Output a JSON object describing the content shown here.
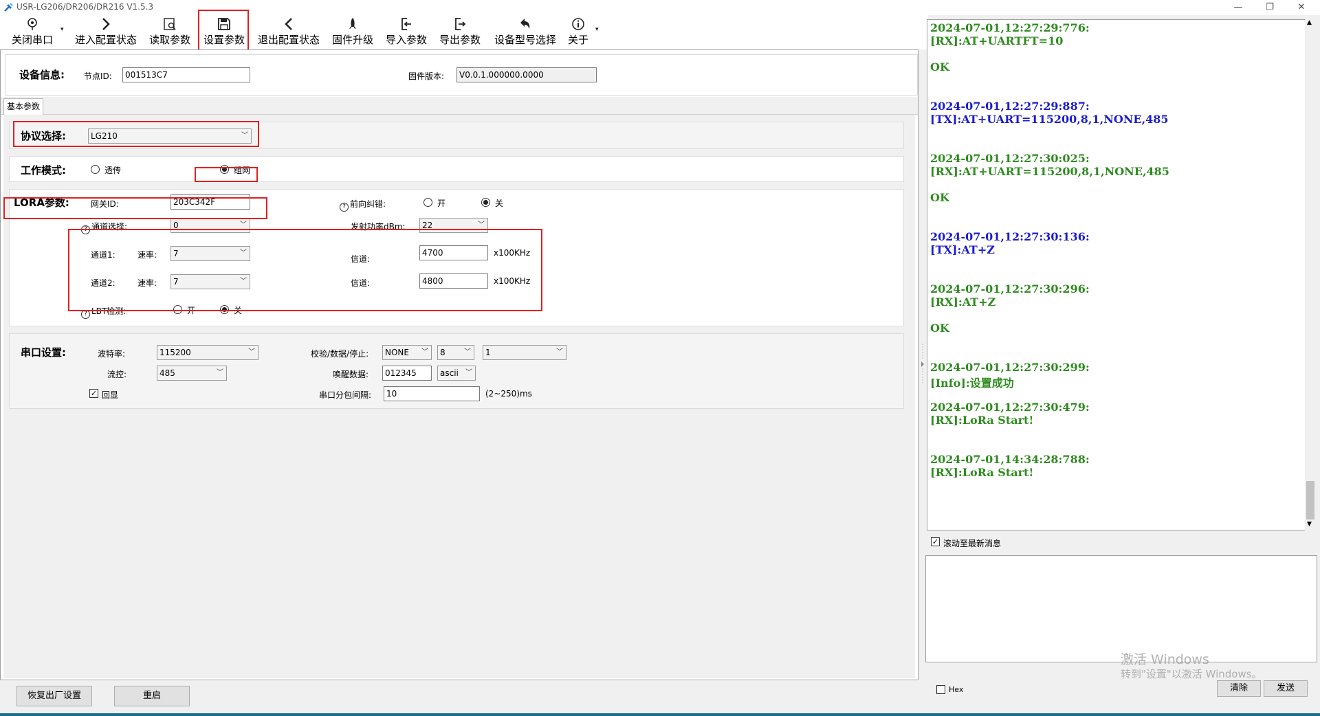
{
  "window": {
    "title": "USR-LG206/DR206/DR216 V1.5.3",
    "icon": "tool-icon"
  },
  "toolbar": {
    "items": [
      {
        "label": "关闭串口",
        "icon": "port-icon"
      },
      {
        "label": "进入配置状态",
        "icon": "chevron-right-icon"
      },
      {
        "label": "读取参数",
        "icon": "read-icon"
      },
      {
        "label": "设置参数",
        "icon": "save-icon"
      },
      {
        "label": "退出配置状态",
        "icon": "chevron-left-icon"
      },
      {
        "label": "固件升级",
        "icon": "rocket-icon"
      },
      {
        "label": "导入参数",
        "icon": "import-icon"
      },
      {
        "label": "导出参数",
        "icon": "export-icon"
      },
      {
        "label": "设备型号选择",
        "icon": "undo-icon"
      },
      {
        "label": "关于",
        "icon": "info-icon"
      }
    ]
  },
  "device": {
    "title": "设备信息:",
    "node_id_label": "节点ID:",
    "node_id": "001513C7",
    "firmware_label": "固件版本:",
    "firmware": "V0.0.1.000000.0000"
  },
  "tabs": {
    "basic": "基本参数"
  },
  "protocol": {
    "label": "协议选择:",
    "value": "LG210"
  },
  "work_mode": {
    "label": "工作模式:",
    "opt_transparent": "透传",
    "opt_network": "组网",
    "selected": "组网"
  },
  "lora": {
    "title": "LORA参数:",
    "gateway_id_label": "网关ID:",
    "gateway_id": "203C342F",
    "fec_label": "前向纠错:",
    "on": "开",
    "off": "关",
    "channel_select_label": "通道选择:",
    "channel_select": "0",
    "tx_power_label": "发射功率dBm:",
    "tx_power": "22",
    "ch1_label": "通道1:",
    "rate_label": "速率:",
    "ch1_rate": "7",
    "channel_label": "信道:",
    "ch1_channel": "4700",
    "unit": "x100KHz",
    "ch2_label": "通道2:",
    "ch2_rate": "7",
    "ch2_channel": "4800",
    "lbt_label": "LBT检测:"
  },
  "serial": {
    "title": "串口设置:",
    "baud_label": "波特率:",
    "baud": "115200",
    "flow_label": "流控:",
    "flow": "485",
    "echo_label": "回显",
    "parity_label": "校验/数据/停止:",
    "parity": "NONE",
    "data_bits": "8",
    "stop_bits": "1",
    "wake_label": "唤醒数据:",
    "wake_data": "012345",
    "wake_format": "ascii",
    "packet_label": "串口分包间隔:",
    "packet_interval": "10",
    "packet_range": "(2~250)ms"
  },
  "bottom": {
    "factory_reset": "恢复出厂设置",
    "restart": "重启"
  },
  "log": {
    "lines": [
      {
        "text": "2024-07-01,12:27:29:776:",
        "kind": "ts"
      },
      {
        "text": "[RX]:AT+UARTFT=10",
        "kind": "rx"
      },
      {
        "text": "OK",
        "kind": "rx"
      },
      {
        "text": "2024-07-01,12:27:29:887:",
        "kind": "tx"
      },
      {
        "text": "[TX]:AT+UART=115200,8,1,NONE,485",
        "kind": "tx"
      },
      {
        "text": "2024-07-01,12:27:30:025:",
        "kind": "ts"
      },
      {
        "text": "[RX]:AT+UART=115200,8,1,NONE,485",
        "kind": "rx"
      },
      {
        "text": "OK",
        "kind": "rx"
      },
      {
        "text": "2024-07-01,12:27:30:136:",
        "kind": "tx"
      },
      {
        "text": "[TX]:AT+Z",
        "kind": "tx"
      },
      {
        "text": "2024-07-01,12:27:30:296:",
        "kind": "ts"
      },
      {
        "text": "[RX]:AT+Z",
        "kind": "rx"
      },
      {
        "text": "OK",
        "kind": "rx"
      },
      {
        "text": "2024-07-01,12:27:30:299:",
        "kind": "ts"
      },
      {
        "text": "[Info]:设置成功",
        "kind": "rx"
      },
      {
        "text": "2024-07-01,12:27:30:479:",
        "kind": "ts"
      },
      {
        "text": "[RX]:LoRa Start!",
        "kind": "rx"
      },
      {
        "text": "2024-07-01,14:34:28:788:",
        "kind": "ts"
      },
      {
        "text": "[RX]:LoRa Start!",
        "kind": "rx"
      }
    ],
    "autoscroll_label": "滚动至最新消息"
  },
  "send": {
    "hex_label": "Hex",
    "clear": "清除",
    "send": "发送"
  },
  "watermark": {
    "line1": "激活 Windows",
    "line2": "转到\"设置\"以激活 Windows。"
  }
}
